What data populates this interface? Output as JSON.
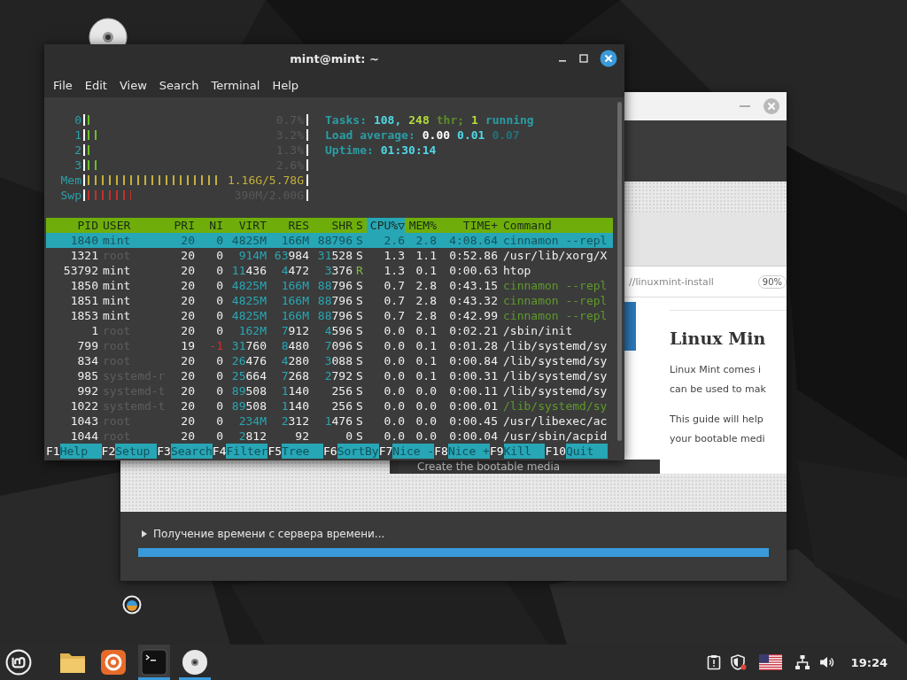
{
  "desktop_icons": [
    {
      "kind": "disc"
    },
    {
      "kind": "installer"
    }
  ],
  "installer": {
    "footer": {
      "status": "Получение времени с сервера времени...",
      "level": 1.0
    },
    "slide": {
      "address": "//linuxmint-install",
      "zoom": "90%",
      "heading": "Linux Min",
      "paragraphs": [
        [
          "Linux Mint comes i",
          "can be used to mak"
        ],
        [
          "This guide will help",
          "your bootable medi"
        ]
      ],
      "caption": "Create the bootable media"
    }
  },
  "terminal": {
    "title": "mint@mint: ~",
    "menu": [
      "File",
      "Edit",
      "View",
      "Search",
      "Terminal",
      "Help"
    ],
    "meters": [
      {
        "label": "0",
        "kind": "cpu",
        "level": 0.02,
        "reading": "0.7%"
      },
      {
        "label": "1",
        "kind": "cpu",
        "level": 0.04,
        "reading": "3.2%"
      },
      {
        "label": "2",
        "kind": "cpu",
        "level": 0.02,
        "reading": "1.3%"
      },
      {
        "label": "3",
        "kind": "cpu",
        "level": 0.04,
        "reading": "2.6%"
      },
      {
        "label": "Mem",
        "kind": "mem",
        "reading": "1.16G/5.78G"
      },
      {
        "label": "Swp",
        "kind": "swap",
        "reading": "390M/2.00G"
      }
    ],
    "stats": [
      [
        {
          "text": "Tasks:",
          "color": "#2a9ea5"
        },
        {
          "text": "108,",
          "color": "#4fd8e6"
        },
        {
          "text": "248",
          "color": "#b4de3a"
        },
        {
          "text": "thr;",
          "color": "#5d8c2a"
        },
        {
          "text": "1",
          "color": "#b4de3a"
        },
        {
          "text": "running",
          "color": "#2a9ea5"
        }
      ],
      [
        {
          "text": "Load average:",
          "color": "#2a9ea5"
        },
        {
          "text": "0.00",
          "color": "#ffffff"
        },
        {
          "text": "0.01",
          "color": "#4fd8e6"
        },
        {
          "text": "0.07",
          "color": "#22727a"
        }
      ],
      [
        {
          "text": "Uptime:",
          "color": "#2a9ea5"
        },
        {
          "text": "01:30:14",
          "color": "#4fd8e6"
        }
      ]
    ],
    "columns": [
      {
        "label": "PID",
        "sorted": false
      },
      {
        "label": "USER",
        "sorted": false
      },
      {
        "label": "PRI",
        "sorted": false
      },
      {
        "label": "NI",
        "sorted": false
      },
      {
        "label": "VIRT",
        "sorted": false
      },
      {
        "label": "RES",
        "sorted": false
      },
      {
        "label": "SHR",
        "sorted": false
      },
      {
        "label": "S",
        "sorted": false
      },
      {
        "label": "CPU%▽",
        "sorted": true
      },
      {
        "label": "MEM%",
        "sorted": false
      },
      {
        "label": "TIME+",
        "sorted": false
      },
      {
        "label": "Command",
        "sorted": false
      }
    ],
    "rows": [
      {
        "cells": [
          "1840",
          "mint",
          "20",
          "0",
          "4825M",
          "166M",
          "88796",
          "S",
          "2.6",
          "2.8",
          "4:08.64",
          "cinnamon --repl"
        ],
        "selected": true
      },
      {
        "cells": [
          "1321",
          "root",
          "20",
          "0",
          "914M",
          "63984",
          "31528",
          "S",
          "1.3",
          "1.1",
          "0:52.86",
          "/usr/lib/xorg/X"
        ],
        "selected": false,
        "user_dimmed": true,
        "thread": false,
        "running": false,
        "ni_alert": false
      },
      {
        "cells": [
          "53792",
          "mint",
          "20",
          "0",
          "11436",
          "4472",
          "3376",
          "R",
          "1.3",
          "0.1",
          "0:00.63",
          "htop"
        ],
        "selected": false,
        "user_dimmed": false,
        "thread": false,
        "running": true,
        "ni_alert": false
      },
      {
        "cells": [
          "1850",
          "mint",
          "20",
          "0",
          "4825M",
          "166M",
          "88796",
          "S",
          "0.7",
          "2.8",
          "0:43.15",
          "cinnamon --repl"
        ],
        "selected": false,
        "user_dimmed": false,
        "thread": true,
        "running": false,
        "ni_alert": false
      },
      {
        "cells": [
          "1851",
          "mint",
          "20",
          "0",
          "4825M",
          "166M",
          "88796",
          "S",
          "0.7",
          "2.8",
          "0:43.32",
          "cinnamon --repl"
        ],
        "selected": false,
        "user_dimmed": false,
        "thread": true,
        "running": false,
        "ni_alert": false
      },
      {
        "cells": [
          "1853",
          "mint",
          "20",
          "0",
          "4825M",
          "166M",
          "88796",
          "S",
          "0.7",
          "2.8",
          "0:42.99",
          "cinnamon --repl"
        ],
        "selected": false,
        "user_dimmed": false,
        "thread": true,
        "running": false,
        "ni_alert": false
      },
      {
        "cells": [
          "1",
          "root",
          "20",
          "0",
          "162M",
          "7912",
          "4596",
          "S",
          "0.0",
          "0.1",
          "0:02.21",
          "/sbin/init"
        ],
        "selected": false,
        "user_dimmed": true,
        "thread": false,
        "running": false,
        "ni_alert": false
      },
      {
        "cells": [
          "799",
          "root",
          "19",
          "-1",
          "31760",
          "8480",
          "7096",
          "S",
          "0.0",
          "0.1",
          "0:01.28",
          "/lib/systemd/sy"
        ],
        "selected": false,
        "user_dimmed": true,
        "thread": false,
        "running": false,
        "ni_alert": true
      },
      {
        "cells": [
          "834",
          "root",
          "20",
          "0",
          "26476",
          "4280",
          "3088",
          "S",
          "0.0",
          "0.1",
          "0:00.84",
          "/lib/systemd/sy"
        ],
        "selected": false,
        "user_dimmed": true,
        "thread": false,
        "running": false,
        "ni_alert": false
      },
      {
        "cells": [
          "985",
          "systemd-r",
          "20",
          "0",
          "25664",
          "7268",
          "2792",
          "S",
          "0.0",
          "0.1",
          "0:00.31",
          "/lib/systemd/sy"
        ],
        "selected": false,
        "user_dimmed": true,
        "thread": false,
        "running": false,
        "ni_alert": false
      },
      {
        "cells": [
          "992",
          "systemd-t",
          "20",
          "0",
          "89508",
          "1140",
          "256",
          "S",
          "0.0",
          "0.0",
          "0:00.11",
          "/lib/systemd/sy"
        ],
        "selected": false,
        "user_dimmed": true,
        "thread": false,
        "running": false,
        "ni_alert": false
      },
      {
        "cells": [
          "1022",
          "systemd-t",
          "20",
          "0",
          "89508",
          "1140",
          "256",
          "S",
          "0.0",
          "0.0",
          "0:00.01",
          "/lib/systemd/sy"
        ],
        "selected": false,
        "user_dimmed": true,
        "thread": true,
        "running": false,
        "ni_alert": false
      },
      {
        "cells": [
          "1043",
          "root",
          "20",
          "0",
          "234M",
          "2312",
          "1476",
          "S",
          "0.0",
          "0.0",
          "0:00.45",
          "/usr/libexec/ac"
        ],
        "selected": false,
        "user_dimmed": true,
        "thread": false,
        "running": false,
        "ni_alert": false
      },
      {
        "cells": [
          "1044",
          "root",
          "20",
          "0",
          "2812",
          "92",
          "0",
          "S",
          "0.0",
          "0.0",
          "0:00.04",
          "/usr/sbin/acpid"
        ],
        "selected": false,
        "user_dimmed": true,
        "thread": false,
        "running": false,
        "ni_alert": false
      }
    ],
    "fkeys": [
      {
        "key": "F1",
        "label": "Help"
      },
      {
        "key": "F2",
        "label": "Setup"
      },
      {
        "key": "F3",
        "label": "Search"
      },
      {
        "key": "F4",
        "label": "Filter"
      },
      {
        "key": "F5",
        "label": "Tree"
      },
      {
        "key": "F6",
        "label": "SortBy"
      },
      {
        "key": "F7",
        "label": "Nice -"
      },
      {
        "key": "F8",
        "label": "Nice +"
      },
      {
        "key": "F9",
        "label": "Kill"
      },
      {
        "key": "F10",
        "label": "Quit"
      }
    ]
  },
  "taskbar": {
    "apps": [
      {
        "kind": "files",
        "running": false,
        "focused": false
      },
      {
        "kind": "browser",
        "running": false,
        "focused": false
      },
      {
        "kind": "terminal",
        "running": true,
        "focused": true
      },
      {
        "kind": "disc",
        "running": true,
        "focused": false
      }
    ],
    "tray": [
      {
        "kind": "notes"
      },
      {
        "kind": "shield"
      },
      {
        "kind": "flag"
      },
      {
        "kind": "network"
      },
      {
        "kind": "volume"
      }
    ],
    "clock": "19:24"
  }
}
